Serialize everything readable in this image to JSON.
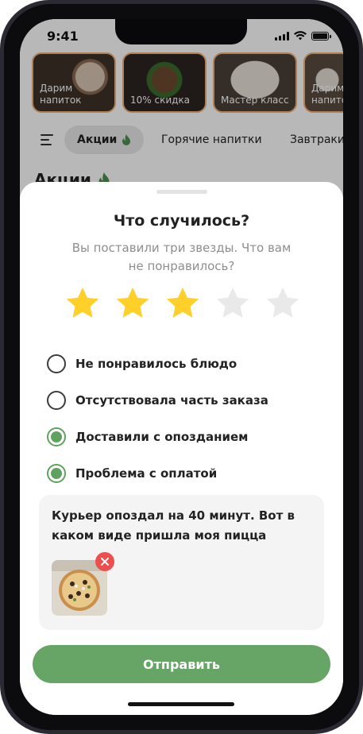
{
  "status_bar": {
    "time": "9:41"
  },
  "promos": [
    {
      "label": "Дарим напиток",
      "icon": "coffee-photo"
    },
    {
      "label": "10% скидка",
      "icon": "burger-photo"
    },
    {
      "label": "Мастер класс",
      "icon": "dish-photo"
    },
    {
      "label": "Дарим напиток",
      "icon": "dish-photo"
    }
  ],
  "categories": {
    "active": "Акции",
    "items": [
      "Горячие напитки",
      "Завтраки"
    ]
  },
  "section_title": "Акции",
  "sheet": {
    "title": "Что случилось?",
    "subtitle": "Вы поставили три звезды. Что вам не понравилось?",
    "rating": {
      "value": 3,
      "max": 5
    },
    "options": [
      {
        "label": "Не понравилось блюдо",
        "checked": false
      },
      {
        "label": "Отсутствовала часть заказа",
        "checked": false
      },
      {
        "label": "Доставили с опозданием",
        "checked": true
      },
      {
        "label": "Проблема с оплатой",
        "checked": true
      }
    ],
    "comment": "Курьер опоздал на 40 минут. Вот в каком виде пришла моя пицца",
    "attachment": {
      "icon": "pizza-photo"
    },
    "submit_label": "Отправить"
  },
  "colors": {
    "accent_green": "#66a565",
    "star_filled": "#ffd02a",
    "star_empty": "#e9e9e9",
    "remove_red": "#ef4e4e",
    "promo_border": "#f2b27b"
  }
}
